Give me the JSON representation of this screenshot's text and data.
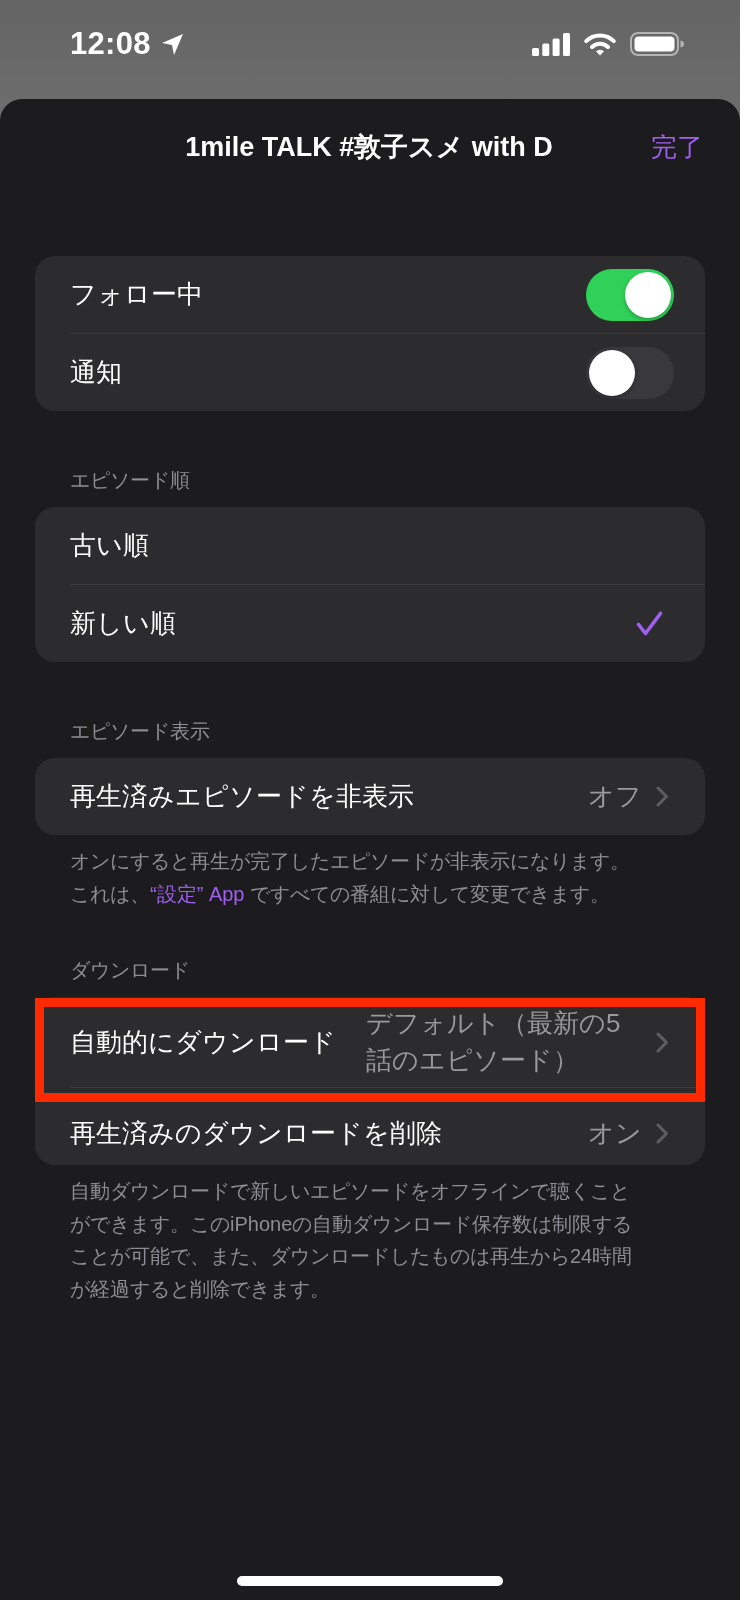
{
  "status_bar": {
    "time": "12:08"
  },
  "sheet": {
    "title": "1mile TALK #敦子スメ with D",
    "done_button": "完了"
  },
  "sections": [
    {
      "rows": [
        {
          "kind": "toggle",
          "label": "フォロー中",
          "on": true
        },
        {
          "kind": "toggle",
          "label": "通知",
          "on": false
        }
      ]
    },
    {
      "header": "エピソード順",
      "rows": [
        {
          "kind": "choice",
          "label": "古い順",
          "selected": false
        },
        {
          "kind": "choice",
          "label": "新しい順",
          "selected": true
        }
      ]
    },
    {
      "header": "エピソード表示",
      "rows": [
        {
          "kind": "disclosure",
          "label": "再生済みエピソードを非表示",
          "value": "オフ",
          "highlighted": false
        }
      ],
      "footer": [
        {
          "kind": "text",
          "text": "オンにすると再生が完了したエピソードが非表示になります。これは、"
        },
        {
          "kind": "link",
          "text": "“設定” App"
        },
        {
          "kind": "text",
          "text": " ですべての番組に対して変更できます。"
        }
      ]
    },
    {
      "header": "ダウンロード",
      "rows": [
        {
          "kind": "disclosure",
          "label": "自動的にダウンロード",
          "value": "デフォルト（最新の5話のエピソード）",
          "highlighted": true
        },
        {
          "kind": "disclosure",
          "label": "再生済みのダウンロードを削除",
          "value": "オン",
          "highlighted": false
        }
      ],
      "footer": [
        {
          "kind": "text",
          "text": "自動ダウンロードで新しいエピソードをオフラインで聴くことができます。このiPhoneの自動ダウンロード保存数は制限することが可能で、また、ダウンロードしたものは再生から24時間が経過すると削除できます。"
        }
      ]
    }
  ]
}
